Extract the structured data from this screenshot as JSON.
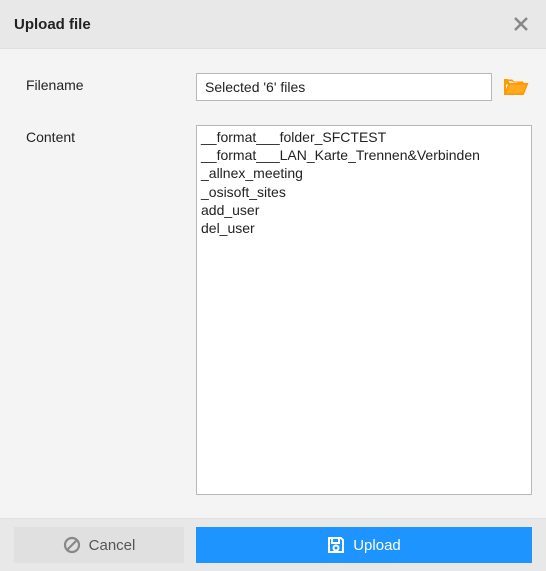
{
  "dialog": {
    "title": "Upload file"
  },
  "form": {
    "filename_label": "Filename",
    "filename_value": "Selected '6' files",
    "content_label": "Content",
    "content_value": "__format___folder_SFCTEST\n__format___LAN_Karte_Trennen&Verbinden\n_allnex_meeting\n_osisoft_sites\nadd_user\ndel_user"
  },
  "buttons": {
    "cancel": "Cancel",
    "upload": "Upload"
  },
  "icons": {
    "close": "close-icon",
    "browse": "folder-open-icon",
    "cancel": "prohibit-icon",
    "upload": "save-icon"
  }
}
